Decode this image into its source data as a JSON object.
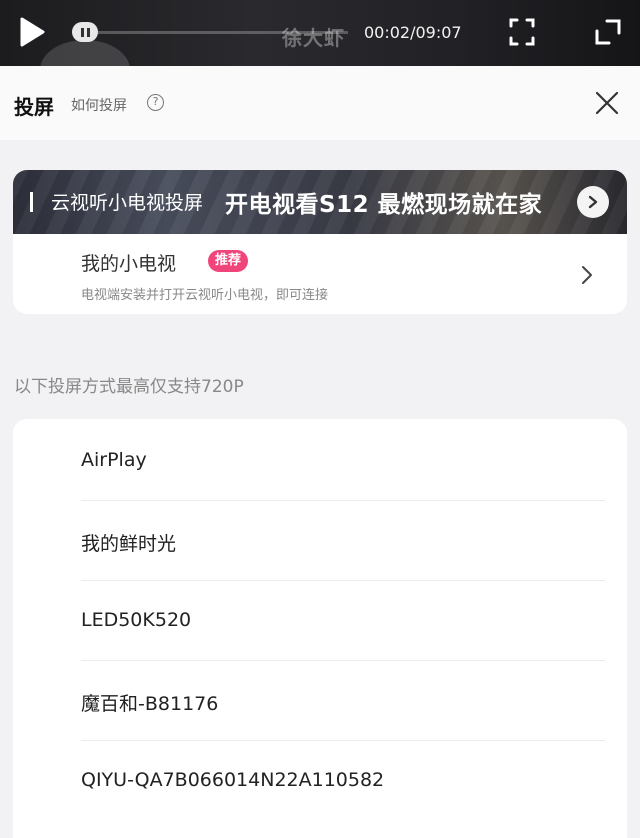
{
  "player": {
    "watermark": "徐大虾",
    "time": "00:02/09:07",
    "progress": 0.004
  },
  "header": {
    "title": "投屏",
    "help_label": "如何投屏",
    "help_icon": "question-circle-icon",
    "close_icon": "close-icon"
  },
  "tv_card": {
    "banner_text": "云视听小电视投屏",
    "banner_headline": "开电视看S12 最燃现场就在家",
    "name": "我的小电视",
    "badge": "推荐",
    "badge_color": "#f0457a",
    "description": "电视端安装并打开云视听小电视，即可连接"
  },
  "notice": "以下投屏方式最高仅支持720P",
  "devices": [
    {
      "label": "AirPlay"
    },
    {
      "label": "我的鲜时光"
    },
    {
      "label": "LED50K520"
    },
    {
      "label": "魔百和-B81176"
    },
    {
      "label": "QIYU-QA7B066014N22A110582"
    }
  ]
}
